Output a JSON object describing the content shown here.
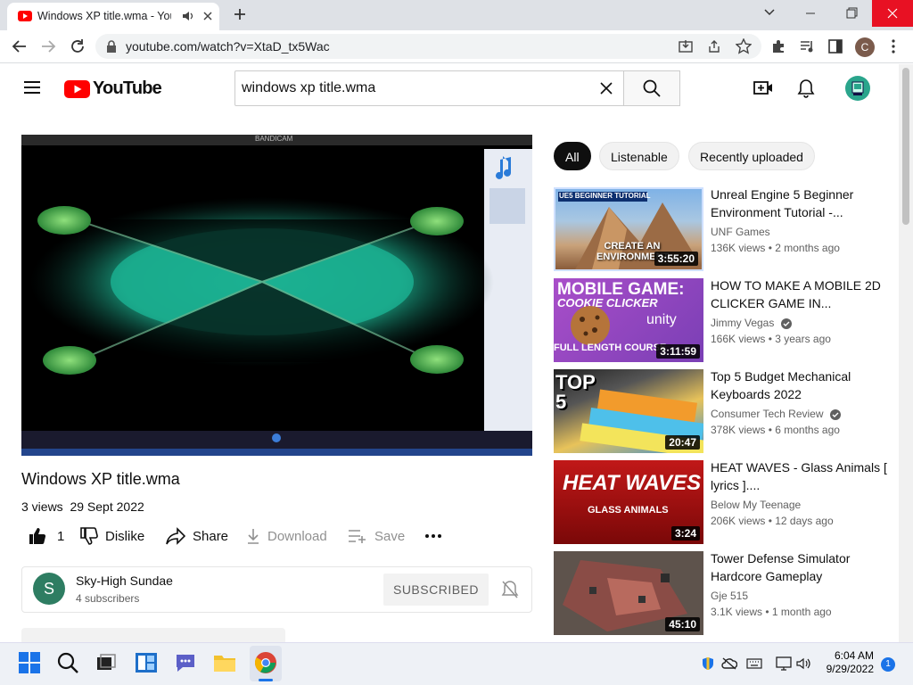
{
  "browser": {
    "tab_title": "Windows XP title.wma - YouTube",
    "url": "youtube.com/watch?v=XtaD_tx5Wac",
    "profile_initial": "C"
  },
  "youtube": {
    "logo_text": "YouTube",
    "search_value": "windows xp title.wma"
  },
  "video": {
    "title": "Windows XP title.wma",
    "views": "3 views",
    "date": "29 Sept 2022",
    "likes": "1",
    "dislike_label": "Dislike",
    "share_label": "Share",
    "download_label": "Download",
    "save_label": "Save",
    "player_banner": "BANDICAM"
  },
  "channel": {
    "initial": "S",
    "name": "Sky-High Sundae",
    "subscribers": "4 subscribers",
    "subscribe_label": "SUBSCRIBED",
    "avatar_color": "#2e7d62"
  },
  "chips": [
    "All",
    "Listenable",
    "Recently uploaded"
  ],
  "recommendations": [
    {
      "title": "Unreal Engine 5 Beginner Environment Tutorial -...",
      "channel": "UNF Games",
      "verified": false,
      "meta": "136K views • 2 months ago",
      "duration": "3:55:20",
      "thumb_text": "CREATE AN ENVIRONMENT",
      "thumb_tag": "UE5 BEGINNER TUTORIAL"
    },
    {
      "title": "HOW TO MAKE A MOBILE 2D CLICKER GAME IN...",
      "channel": "Jimmy Vegas",
      "verified": true,
      "meta": "166K views • 3 years ago",
      "duration": "3:11:59",
      "thumb_text": "MOBILE GAME:",
      "thumb_sub": "COOKIE CLICKER",
      "thumb_foot": "FULL LENGTH COURSE",
      "thumb_brand": "unity"
    },
    {
      "title": "Top 5 Budget Mechanical Keyboards 2022",
      "channel": "Consumer Tech Review",
      "verified": true,
      "meta": "378K views • 6 months ago",
      "duration": "20:47",
      "thumb_text": "TOP 5"
    },
    {
      "title": "HEAT WAVES - Glass Animals [ lyrics ]....",
      "channel": "Below My Teenage",
      "verified": false,
      "meta": "206K views • 12 days ago",
      "duration": "3:24",
      "thumb_text": "HEAT WAVES",
      "thumb_sub": "GLASS ANIMALS"
    },
    {
      "title": "Tower Defense Simulator Hardcore Gameplay",
      "channel": "Gje 515",
      "verified": false,
      "meta": "3.1K views • 1 month ago",
      "duration": "45:10"
    }
  ],
  "taskbar": {
    "time": "6:04 AM",
    "date": "9/29/2022",
    "notification_count": "1"
  },
  "colors": {
    "youtube_red": "#ff0000",
    "chip_active": "#0f0f0f",
    "close_button": "#e81123"
  }
}
